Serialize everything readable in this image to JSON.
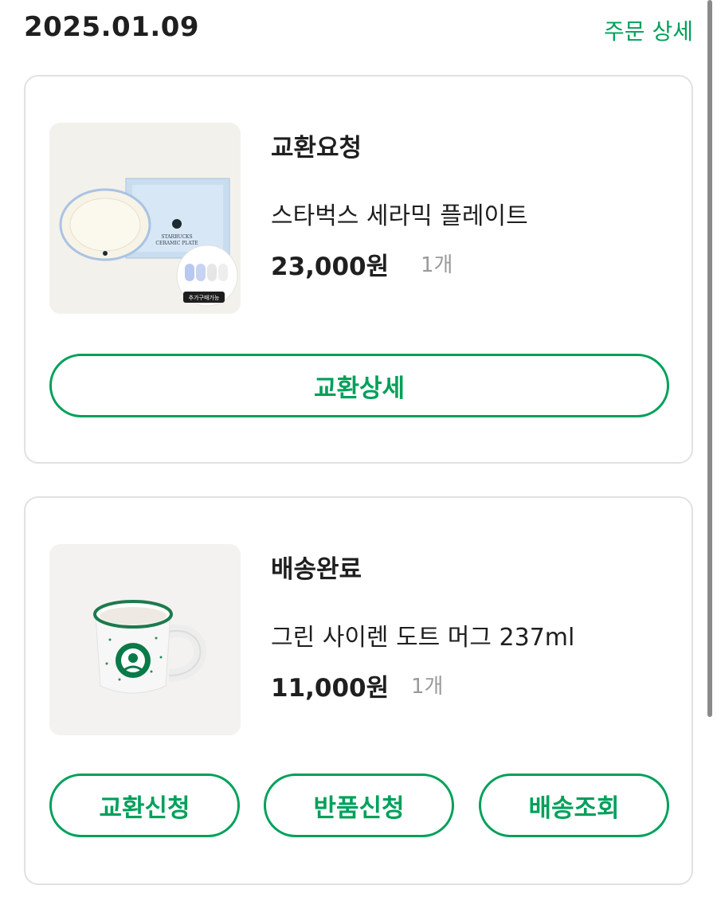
{
  "header": {
    "date": "2025.01.09",
    "order_detail_label": "주문 상세"
  },
  "orders": [
    {
      "status": "교환요청",
      "product_name": "스타벅스 세라믹 플레이트",
      "price": "23,000원",
      "quantity": "1개",
      "image": {
        "box_text_line1": "STARBUCKS",
        "box_text_line2": "CERAMIC PLATE",
        "tag_text": "추가구매가능"
      },
      "buttons": [
        "교환상세"
      ]
    },
    {
      "status": "배송완료",
      "product_name": "그린 사이렌 도트 머그 237ml",
      "price": "11,000원",
      "quantity": "1개",
      "buttons": [
        "교환신청",
        "반품신청",
        "배송조회"
      ]
    }
  ],
  "colors": {
    "accent": "#00a05a",
    "text": "#1f1f1f",
    "muted": "#9a9a9a",
    "card_border": "#e1e1e1"
  }
}
